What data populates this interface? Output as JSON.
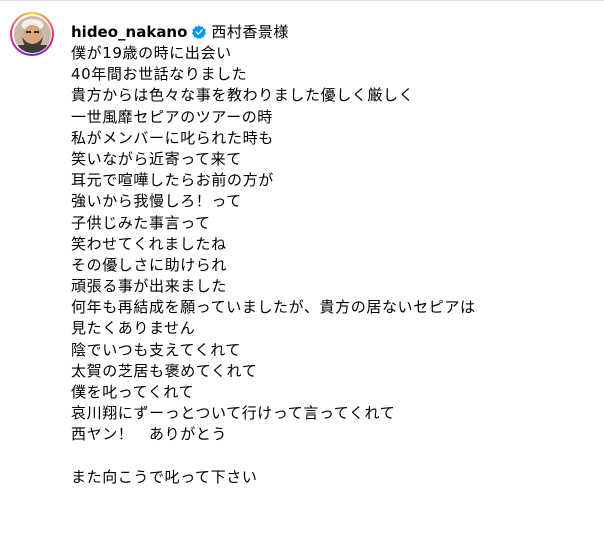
{
  "post": {
    "username": "hideo_nakano",
    "verified_icon": "verified-badge-icon",
    "mention": "西村香景様",
    "caption_lines": [
      "僕が19歳の時に出会い",
      "40年間お世話なりました",
      "貴方からは色々な事を教わりました優しく厳しく",
      "一世風靡セピアのツアーの時",
      "私がメンバーに叱られた時も",
      "笑いながら近寄って来て",
      "耳元で喧嘩したらお前の方が",
      "強いから我慢しろ！って",
      "子供じみた事言って",
      "笑わせてくれましたね",
      "その優しさに助けられ",
      "頑張る事が出来ました",
      "何年も再結成を願っていましたが、貴方の居ないセピアは",
      "見たくありません",
      "陰でいつも支えてくれて",
      "太賀の芝居も褒めてくれて",
      "僕を叱ってくれて",
      "哀川翔にずーっとついて行けって言ってくれて",
      "西ヤン！　ありがとう",
      "",
      "また向こうで叱って下さい"
    ],
    "colors": {
      "verified": "#0095f6",
      "divider": "#dbdbdb",
      "text": "#000000"
    }
  }
}
